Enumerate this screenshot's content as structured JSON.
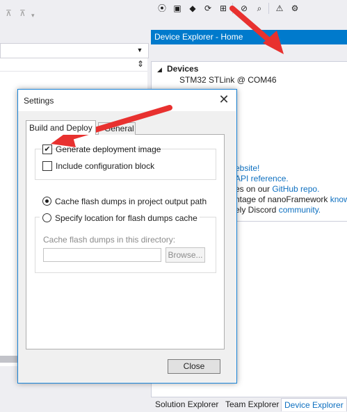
{
  "colors": {
    "accent": "#007acc",
    "link": "#0e70c0",
    "arrow": "#e8312f"
  },
  "topbar": {
    "icons": [
      "pin-icon",
      "pin-icon",
      "dropdown-icon"
    ]
  },
  "device_explorer": {
    "title": "Device Explorer - Home",
    "toolbar_icons": [
      "ping-icon",
      "device-capabilities-icon",
      "erase-icon",
      "reboot-icon",
      "network-config-icon",
      "disable-icon",
      "search-icon",
      "warning-icon",
      "gear-icon"
    ],
    "devices_header": "Devices",
    "devices": [
      "STM32 STLink @ COM46"
    ],
    "info": {
      "line1_link": "ebsite!",
      "line2_link": "API reference.",
      "line3_text": "es on our ",
      "line3_link": "GitHub repo.",
      "line4_text": "ntage of nanoFramework ",
      "line4_link": "know",
      "line5_text": "ely Discord ",
      "line5_link": "community."
    },
    "tabs": [
      "Solution Explorer",
      "Team Explorer",
      "Device Explorer"
    ]
  },
  "settings_dialog": {
    "title": "Settings",
    "tabs": [
      "Build and Deploy",
      "General"
    ],
    "options": {
      "generate_deployment_image": {
        "label": "Generate deployment image",
        "checked": true
      },
      "include_configuration_block": {
        "label": "Include configuration block",
        "checked": false
      }
    },
    "radios": {
      "cache_in_output": {
        "label": "Cache flash dumps in project output path",
        "selected": true
      },
      "specify_location": {
        "label": "Specify location for flash dumps cache",
        "selected": false
      }
    },
    "directory_label": "Cache flash dumps in this directory:",
    "directory_value": "",
    "browse_label": "Browse...",
    "close_label": "Close"
  }
}
